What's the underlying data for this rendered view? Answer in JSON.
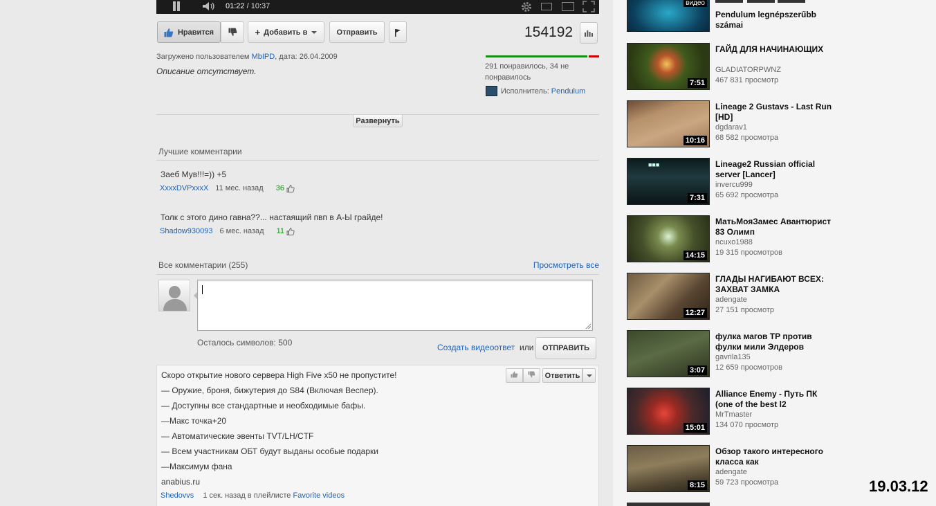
{
  "player": {
    "current_time": "01:22",
    "separator": "/",
    "duration": "10:37"
  },
  "actions": {
    "like_label": "Нравится",
    "add_label": "Добавить в",
    "share_label": "Отправить",
    "view_count": "154192"
  },
  "info": {
    "uploaded_prefix": "Загружено пользователем",
    "uploader": "MbIPD",
    "date_label": ", дата: 26.04.2009",
    "description": "Описание отсутствует.",
    "ratings_text": "291 понравилось, 34 не понравилось",
    "likes_fraction": 0.895,
    "artist_label": "Исполнитель:",
    "artist_name": "Pendulum",
    "expand_label": "Развернуть"
  },
  "top_comments": {
    "title": "Лучшие комментарии",
    "items": [
      {
        "text": "Заеб Мув!!!=)) +5",
        "user": "XxxxDVPxxxX",
        "time": "11 мес. назад",
        "likes": "36"
      },
      {
        "text": "Толк с этого дино гавна??... настаящий пвп в А-Ы грайде!",
        "user": "Shadow930093",
        "time": "6 мес. назад",
        "likes": "11"
      }
    ]
  },
  "all_comments": {
    "title": "Все комментарии (255)",
    "view_all": "Просмотреть все",
    "chars_left": "Осталось символов: 500",
    "create_video_reply": "Создать видеоответ",
    "or": "или",
    "submit": "ОТПРАВИТЬ"
  },
  "latest_comment": {
    "lines": [
      "Скоро открытие нового сервера High Five x50 не пропустите!",
      "— Оружие, броня, бижутерия до S84 (Включая Веспер).",
      "— Доступны все стандартные и необходимые бафы.",
      "—Макс точка+20",
      "— Автоматические эвенты TVT/LH/CTF",
      "— Всем участникам ОБТ будут выданы особые подарки",
      "—Максимум фана",
      "anabius.ru"
    ],
    "user": "Shedovvs",
    "time": "1 сек. назад в плейлисте",
    "playlist": "Favorite videos",
    "reply_label": "Ответить"
  },
  "sidebar": {
    "top_video": {
      "badge": "видео",
      "title": "Pendulum legnépszerűbb számai"
    },
    "videos": [
      {
        "title": "ГАЙД ДЛЯ НАЧИНАЮЩИХ",
        "author": "GLADIATORPWNZ",
        "views": "467 831 просмотр",
        "duration": "7:51"
      },
      {
        "title": "Lineage 2 Gustavs - Last Run [HD]",
        "author": "dgdarav1",
        "views": "68 582 просмотра",
        "duration": "10:16"
      },
      {
        "title": "Lineage2 Russian official server [Lancer]",
        "author": "invercu999",
        "views": "65 692 просмотра",
        "duration": "7:31"
      },
      {
        "title": "МатьМояЗамес Авантюрист 83 Олимп",
        "author": "ncuxo1988",
        "views": "19 315 просмотров",
        "duration": "14:15"
      },
      {
        "title": "ГЛАДЫ НАГИБАЮТ ВСЕХ: ЗАХВАТ ЗАМКА",
        "author": "adengate",
        "views": "27 151 просмотр",
        "duration": "12:27"
      },
      {
        "title": "фулка магов ТР против фулки мили Элдеров",
        "author": "gavrila135",
        "views": "12 659 просмотров",
        "duration": "3:07"
      },
      {
        "title": "Alliance Enemy - Путь ПК (one of the best l2",
        "author": "MrTmaster",
        "views": "134 070 просмотр",
        "duration": "15:01"
      },
      {
        "title": "Обзор такого интересного класса как",
        "author": "adengate",
        "views": "59 723 просмотра",
        "duration": "8:15"
      }
    ]
  },
  "date_stamp": "19.03.12"
}
